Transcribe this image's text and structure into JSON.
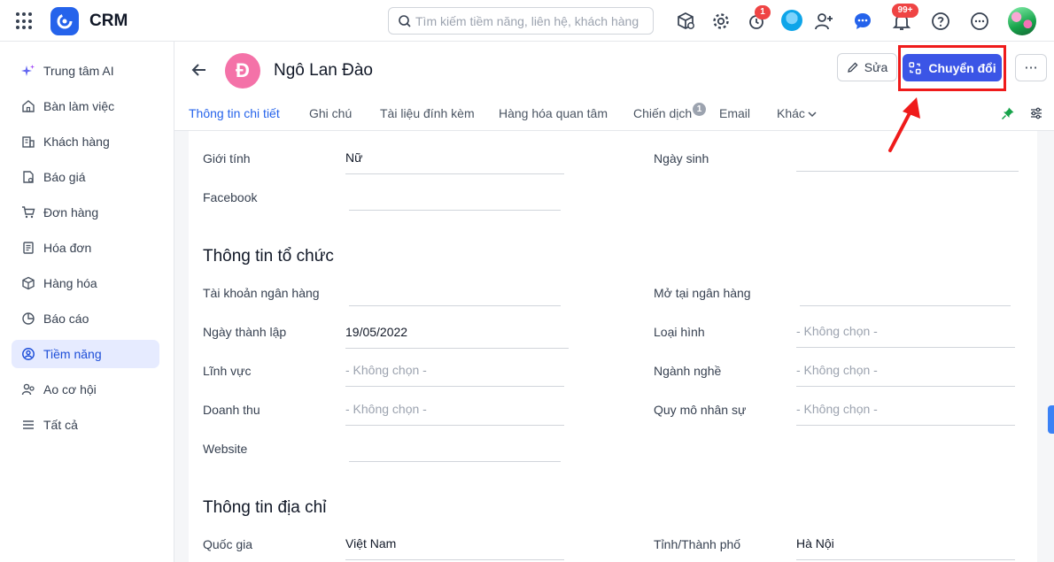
{
  "app": {
    "brand": "CRM"
  },
  "search": {
    "placeholder": "Tìm kiếm tiềm năng, liên hệ, khách hàng"
  },
  "topbar": {
    "reminder_badge": "1",
    "notification_badge": "99+"
  },
  "sidebar": {
    "items": [
      {
        "label": "Trung tâm AI",
        "icon": "sparkle-icon",
        "active": false
      },
      {
        "label": "Bàn làm việc",
        "icon": "home-icon",
        "active": false
      },
      {
        "label": "Khách hàng",
        "icon": "building-icon",
        "active": false
      },
      {
        "label": "Báo giá",
        "icon": "quote-icon",
        "active": false
      },
      {
        "label": "Đơn hàng",
        "icon": "cart-icon",
        "active": false
      },
      {
        "label": "Hóa đơn",
        "icon": "invoice-icon",
        "active": false
      },
      {
        "label": "Hàng hóa",
        "icon": "box-icon",
        "active": false
      },
      {
        "label": "Báo cáo",
        "icon": "pie-chart-icon",
        "active": false
      },
      {
        "label": "Tiềm năng",
        "icon": "lead-icon",
        "active": true
      },
      {
        "label": "Ao cơ hội",
        "icon": "opportunity-icon",
        "active": false
      },
      {
        "label": "Tất cả",
        "icon": "menu-icon",
        "active": false
      }
    ]
  },
  "header": {
    "avatar_letter": "Đ",
    "name": "Ngô Lan Đào",
    "edit_label": "Sửa",
    "convert_label": "Chuyển đổi",
    "more_label": "···"
  },
  "tabs": {
    "items": [
      {
        "label": "Thông tin chi tiết",
        "active": true
      },
      {
        "label": "Ghi chú",
        "active": false
      },
      {
        "label": "Tài liệu đính kèm",
        "active": false
      },
      {
        "label": "Hàng hóa quan tâm",
        "active": false
      },
      {
        "label": "Chiến dịch",
        "active": false
      },
      {
        "label": "Email",
        "active": false
      },
      {
        "label": "Khác",
        "active": false
      }
    ],
    "campaign_count": "1"
  },
  "personal": {
    "gender_label": "Giới tính",
    "gender_value": "Nữ",
    "birthday_label": "Ngày sinh",
    "birthday_value": "",
    "facebook_label": "Facebook",
    "facebook_value": ""
  },
  "organization": {
    "title": "Thông tin tổ chức",
    "bank_account_label": "Tài khoản ngân hàng",
    "bank_account_value": "",
    "bank_label": "Mở tại ngân hàng",
    "bank_value": "",
    "founded_label": "Ngày thành lập",
    "founded_value": "19/05/2022",
    "type_label": "Loại hình",
    "type_value": "- Không chọn -",
    "field_label": "Lĩnh vực",
    "field_value": "- Không chọn -",
    "industry_label": "Ngành nghề",
    "industry_value": "- Không chọn -",
    "revenue_label": "Doanh thu",
    "revenue_value": "- Không chọn -",
    "staff_label": "Quy mô nhân sự",
    "staff_value": "- Không chọn -",
    "website_label": "Website",
    "website_value": ""
  },
  "address": {
    "title": "Thông tin địa chỉ",
    "country_label": "Quốc gia",
    "country_value": "Việt Nam",
    "province_label": "Tỉnh/Thành phố",
    "province_value": "Hà Nội"
  },
  "colors": {
    "accent": "#3b55e6",
    "highlight": "#ef1b1b",
    "avatar": "#f472a8"
  }
}
